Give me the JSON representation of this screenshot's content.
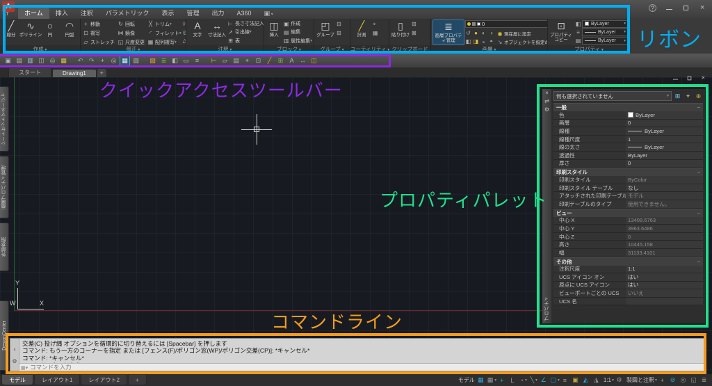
{
  "annotations": {
    "colors": {
      "ribbon": "#00aeef",
      "qat": "#8b2be2",
      "palette": "#21e08c",
      "cmdline": "#f59b1e"
    },
    "ribbon_label": "リボン",
    "qat_label": "クイックアクセスツールバー",
    "palette_label": "プロパティパレット",
    "cmdline_label": "コマンドライン"
  },
  "titlebar": {
    "logo": "A",
    "logo_sub": "LT"
  },
  "ribbon": {
    "tabs": [
      {
        "name": "tab-home",
        "label": "ホーム",
        "cls": "active"
      },
      {
        "name": "tab-insert",
        "label": "挿入"
      },
      {
        "name": "tab-annotate",
        "label": "注釈"
      },
      {
        "name": "tab-parametric",
        "label": "パラメトリック"
      },
      {
        "name": "tab-view",
        "label": "表示"
      },
      {
        "name": "tab-manage",
        "label": "管理"
      },
      {
        "name": "tab-output",
        "label": "出力"
      },
      {
        "name": "tab-a360",
        "label": "A360"
      },
      {
        "name": "featured-apps-icon",
        "label": "",
        "cls": "cam"
      }
    ],
    "panels": {
      "draw": {
        "footer": "作成",
        "buttons": [
          {
            "name": "line-button",
            "label": "線分",
            "g": "╱"
          },
          {
            "name": "polyline-button",
            "label": "ポリライン",
            "g": "∿"
          },
          {
            "name": "circle-button",
            "label": "円",
            "g": "○"
          },
          {
            "name": "arc-button",
            "label": "円弧",
            "g": "◠"
          }
        ],
        "flyouts": [
          {
            "name": "rectangle-flyout-icon",
            "g": "▭"
          },
          {
            "name": "ellipse-flyout-icon",
            "g": "◯"
          },
          {
            "name": "hatch-flyout-icon",
            "g": "▨"
          }
        ]
      },
      "modify": {
        "footer": "修正",
        "buttons": [
          {
            "name": "move-button",
            "label": "移動",
            "g": "+"
          },
          {
            "name": "copy-button",
            "label": "複写",
            "g": "⊡"
          },
          {
            "name": "stretch-button",
            "label": "ストレッチ",
            "g": "▱"
          },
          {
            "name": "rotate-button",
            "label": "回転",
            "g": "↻"
          },
          {
            "name": "mirror-button",
            "label": "鏡像",
            "g": "⋈"
          },
          {
            "name": "scale-button",
            "label": "尺度変更",
            "g": "◱"
          },
          {
            "name": "trim-button",
            "label": "トリム",
            "g": "╳",
            "dd": "▾"
          },
          {
            "name": "fillet-button",
            "label": "フィレット",
            "g": "◜",
            "dd": "▾"
          },
          {
            "name": "array-button",
            "label": "配列複写",
            "g": "▦",
            "dd": "▾"
          }
        ],
        "extras": [
          {
            "name": "erase-icon",
            "g": "◊",
            "c": "#c98a8a"
          },
          {
            "name": "explode-icon",
            "g": "◎",
            "c": "#8ab0c9"
          },
          {
            "name": "overkill-icon",
            "g": "△",
            "c": "#b5b5b5"
          }
        ]
      },
      "annotate": {
        "footer": "注釈",
        "big": [
          {
            "name": "text-button",
            "label": "文字",
            "g": "A"
          },
          {
            "name": "dimension-button",
            "label": "寸法記入",
            "g": "↔"
          }
        ],
        "small": [
          {
            "name": "linear-dimension-button",
            "label": "長さ寸法記入",
            "g": "⊢",
            "dd": "▾"
          },
          {
            "name": "leader-button",
            "label": "引出線",
            "g": "↗",
            "dd": "▾"
          },
          {
            "name": "table-button",
            "label": "表",
            "g": "⊞"
          }
        ]
      },
      "block": {
        "footer": "ブロック",
        "big": {
          "name": "insert-button",
          "label": "挿入",
          "g": "◫"
        },
        "small": [
          {
            "name": "block-create-button",
            "label": "作成",
            "g": "▣"
          },
          {
            "name": "block-edit-button",
            "label": "編集",
            "g": "▤"
          },
          {
            "name": "attribute-edit-button",
            "label": "属性編集",
            "g": "▥",
            "dd": "▾"
          }
        ]
      },
      "group": {
        "footer": "グループ",
        "big": {
          "name": "group-button",
          "label": "グループ",
          "g": "◰"
        },
        "extras": [
          {
            "name": "ungroup-icon",
            "g": "⊟",
            "c": "#b5b5b5"
          },
          {
            "name": "group-edit-icon",
            "g": "⊞",
            "c": "#b5b5b5"
          }
        ]
      },
      "utility": {
        "footer": "ユーティリティ",
        "big": {
          "name": "measure-button",
          "label": "計測",
          "g": "╱",
          "dd": "▾"
        },
        "extras": [
          {
            "name": "quick-select-icon",
            "g": "⌖",
            "c": "#b5b5b5"
          },
          {
            "name": "quick-calc-icon",
            "g": "▦",
            "c": "#b5b5b5"
          }
        ]
      },
      "clipboard": {
        "footer": "クリップボード",
        "big": {
          "name": "paste-button",
          "label": "貼り付け",
          "g": "▯",
          "dd": "▾"
        },
        "extras": [
          {
            "name": "copy-clip-icon",
            "g": "⊞",
            "c": "#b5b5b5"
          },
          {
            "name": "cut-icon",
            "g": "⊠",
            "c": "#b5b5b5"
          }
        ]
      },
      "layer": {
        "footer": "画層",
        "big": {
          "name": "layer-properties-button",
          "label": "画層プロパティ管理",
          "g": "≣"
        },
        "combo": "0",
        "tools": [
          {
            "name": "layer-tool-icon",
            "g": "↺",
            "c": "#8ab0c9"
          },
          {
            "name": "layer-tool-icon",
            "g": "●",
            "c": "#d8c23a"
          },
          {
            "name": "layer-tool-icon",
            "g": "◐",
            "c": "#b5b5b5"
          },
          {
            "name": "layer-tool-icon",
            "g": "◑",
            "c": "#7ab648"
          },
          {
            "name": "layer-tool-icon",
            "g": "◧",
            "c": "#b5b5b5"
          },
          {
            "name": "layer-tool-icon",
            "g": "◨",
            "c": "#d8c23a"
          },
          {
            "name": "layer-tool-icon",
            "g": "◒",
            "c": "#8ab0c9"
          },
          {
            "name": "layer-tool-icon",
            "g": "◓",
            "c": "#b5b5b5"
          }
        ],
        "actions": [
          {
            "name": "set-current-layer-button",
            "label": "現在層に設定",
            "g": "◉",
            "c": "#d8c23a"
          },
          {
            "name": "move-to-layer-button",
            "label": "オブジェクトを指定の画層に移動",
            "g": "↘",
            "c": "#8ab0c9"
          }
        ]
      },
      "properties": {
        "footer": "プロパティ",
        "big": {
          "name": "match-properties-button",
          "label": "プロパティコピー",
          "g": "⊡"
        },
        "dropdowns": [
          "ByLayer",
          "ByLayer",
          "ByLayer"
        ]
      }
    }
  },
  "qat_icons": [
    {
      "name": "workspace-icon",
      "g": "▣",
      "c": "#b5b5b5"
    },
    {
      "name": "menu-icon",
      "g": "▤",
      "c": "#b5b5b5"
    },
    {
      "name": "print-icon",
      "g": "▥",
      "c": "#9fc3e8"
    },
    {
      "name": "plotter-icon",
      "g": "◫",
      "c": "#b5b5b5"
    },
    {
      "name": "preview-icon",
      "g": "◎",
      "c": "#b5b5b5"
    },
    {
      "name": "publish-icon",
      "g": "▦",
      "c": "#d8c23a"
    },
    {
      "name": "separator",
      "cls": "sep"
    },
    {
      "name": "undo-icon",
      "g": "↶",
      "c": "#8ab0c9"
    },
    {
      "name": "redo-icon",
      "g": "↷",
      "c": "#8ab0c9"
    },
    {
      "name": "pan-icon",
      "g": "+",
      "c": "#b5b5b5"
    },
    {
      "name": "zoom-realtime-icon",
      "g": "◎",
      "c": "#b5b5b5"
    },
    {
      "name": "zoom-window-icon",
      "g": "▦",
      "c": "#eaeaea",
      "cls": "on"
    },
    {
      "name": "zoom-previous-icon",
      "g": "▧",
      "c": "#b5b5b5"
    },
    {
      "name": "separator",
      "cls": "sep"
    },
    {
      "name": "properties-icon",
      "g": "▨",
      "c": "#e8a33d"
    },
    {
      "name": "layers-icon",
      "g": "≣",
      "c": "#7ab648"
    },
    {
      "name": "color-icon",
      "g": "◧",
      "c": "#b5b5b5"
    },
    {
      "name": "linetype-icon",
      "g": "▭",
      "c": "#b5b5b5"
    },
    {
      "name": "lineweight-icon",
      "g": "≡",
      "c": "#b5b5b5"
    },
    {
      "name": "separator",
      "cls": "sep"
    },
    {
      "name": "distance-icon",
      "g": "⊢",
      "c": "#d8c23a"
    },
    {
      "name": "area-icon",
      "g": "▱",
      "c": "#b5b5b5"
    },
    {
      "name": "list-icon",
      "g": "▤",
      "c": "#b5b5b5"
    },
    {
      "name": "id-point-icon",
      "g": "⌖",
      "c": "#8ab0c9"
    },
    {
      "name": "match-icon",
      "g": "⊡",
      "c": "#b5b5b5"
    },
    {
      "name": "measure-icon",
      "g": "╱",
      "c": "#e8a33d"
    },
    {
      "name": "table-icon",
      "g": "⊞",
      "c": "#7ab648"
    },
    {
      "name": "text-icon",
      "g": "A",
      "c": "#b5b5b5"
    },
    {
      "name": "dim-icon",
      "g": "↔",
      "c": "#8ab0c9"
    },
    {
      "name": "block-icon",
      "g": "◫",
      "c": "#e8a33d"
    }
  ],
  "file_tabs": {
    "start": "スタート",
    "drawing": "Drawing1",
    "add": "+"
  },
  "left_tabs": {
    "sheetset": "シートセットマネージャ",
    "layer": "画層プロパティ管理",
    "xref": "外部参照",
    "designcenter": "DesignCenter"
  },
  "ucs": {
    "x": "X",
    "y": "Y",
    "w": "W"
  },
  "palette": {
    "selection": "何も選択されていません",
    "strip_title": "プロパティ",
    "sections": [
      {
        "title": "一般",
        "rows": [
          {
            "label": "色",
            "value": "ByLayer",
            "cls": "swatch"
          },
          {
            "label": "画層",
            "value": "0"
          },
          {
            "label": "線種",
            "value": "ByLayer",
            "cls": "line"
          },
          {
            "label": "線種尺度",
            "value": "1"
          },
          {
            "label": "線の太さ",
            "value": "ByLayer",
            "cls": "line"
          },
          {
            "label": "透過性",
            "value": "ByLayer"
          },
          {
            "label": "厚さ",
            "value": "0"
          }
        ]
      },
      {
        "title": "印刷スタイル",
        "rows": [
          {
            "label": "印刷スタイル",
            "value": "ByColor",
            "cls": "ro"
          },
          {
            "label": "印刷スタイル テーブル",
            "value": "なし"
          },
          {
            "label": "アタッチされた印刷テーブル",
            "value": "モデル",
            "cls": "ro"
          },
          {
            "label": "印刷テーブルのタイプ",
            "value": "使用できません。",
            "cls": "ro"
          }
        ]
      },
      {
        "title": "ビュー",
        "rows": [
          {
            "label": "中心 X",
            "value": "13408.6763",
            "cls": "ro"
          },
          {
            "label": "中心 Y",
            "value": "3963.6486",
            "cls": "ro"
          },
          {
            "label": "中心 Z",
            "value": "0",
            "cls": "ro"
          },
          {
            "label": "高さ",
            "value": "10445.158",
            "cls": "ro"
          },
          {
            "label": "幅",
            "value": "31133.4101",
            "cls": "ro"
          }
        ]
      },
      {
        "title": "その他",
        "rows": [
          {
            "label": "注釈尺度",
            "value": "1:1"
          },
          {
            "label": "UCS アイコン オン",
            "value": "はい"
          },
          {
            "label": "原点に UCS アイコン",
            "value": "はい"
          },
          {
            "label": "ビューポートごとの UCS",
            "value": "いいえ",
            "cls": "ro"
          },
          {
            "label": "UCS 名",
            "value": ""
          }
        ]
      }
    ]
  },
  "command": {
    "lines": [
      "交差(C) 投げ縄  オプションを循環的に切り替えるには [Spacebar] を押します",
      "コマンド: もう一方のコーナーを指定 または [フェンス(F)/ポリゴン窓(WP)/ポリゴン交差(CP)]: *キャンセル*",
      "コマンド: *キャンセル*",
      "コマンド: *キャンセル*"
    ],
    "placeholder": "コマンドを入力"
  },
  "layout_tabs": [
    {
      "name": "tab-model",
      "label": "モデル",
      "cls": "active"
    },
    {
      "name": "tab-layout1",
      "label": "レイアウト1"
    },
    {
      "name": "tab-layout2",
      "label": "レイアウト2"
    },
    {
      "name": "tab-new-layout",
      "label": "+"
    }
  ],
  "statusbar": {
    "items": [
      {
        "name": "model-space-label",
        "t": "モデル",
        "c": "#c9c9c9"
      },
      {
        "name": "grid-icon",
        "g": "▦",
        "c": "#2da8e0"
      },
      {
        "name": "snap-icon",
        "g": "▦",
        "c": "#9a9a9a",
        "dd": "▾"
      },
      {
        "name": "dynamic-input-icon",
        "g": "+",
        "c": "#2da8e0"
      },
      {
        "name": "ortho-icon",
        "g": "L",
        "c": "#9a9a9a"
      },
      {
        "name": "polar-tracking-icon",
        "g": "◔",
        "c": "#9a9a9a",
        "dd": "▾"
      },
      {
        "name": "isodraft-icon",
        "g": "╲",
        "c": "#9a9a9a",
        "dd": "▾"
      },
      {
        "name": "otrack-icon",
        "g": "∠",
        "c": "#2da8e0"
      },
      {
        "name": "osnap-icon",
        "g": "▢",
        "c": "#2da8e0",
        "dd": "▾"
      },
      {
        "name": "lineweight-icon",
        "g": "≡",
        "c": "#9a9a9a"
      },
      {
        "name": "selection-cycling-icon",
        "g": "▣",
        "c": "#c9a53a"
      },
      {
        "name": "annotation-visibility-icon",
        "g": "◭",
        "c": "#2da8e0"
      },
      {
        "name": "autoscale-icon",
        "g": "◮",
        "c": "#9a9a9a"
      },
      {
        "name": "annotation-scale",
        "t": "1:1",
        "c": "#c9c9c9",
        "dd": "▾"
      },
      {
        "name": "workspace-gear-icon",
        "g": "⚙",
        "c": "#9a9a9a"
      },
      {
        "name": "workspace-switch",
        "t": "製図と注釈",
        "c": "#c9c9c9",
        "dd": "▾"
      },
      {
        "name": "annotation-monitor-icon",
        "g": "+",
        "c": "#9a9a9a"
      },
      {
        "name": "quick-properties-icon",
        "g": "⊘",
        "c": "#2da8e0"
      },
      {
        "name": "isolate-objects-icon",
        "g": "◎",
        "c": "#9a9a9a"
      },
      {
        "name": "clean-screen-icon",
        "g": "◱",
        "c": "#9a9a9a"
      },
      {
        "name": "customize-icon",
        "g": "≣",
        "c": "#9a9a9a"
      }
    ]
  }
}
